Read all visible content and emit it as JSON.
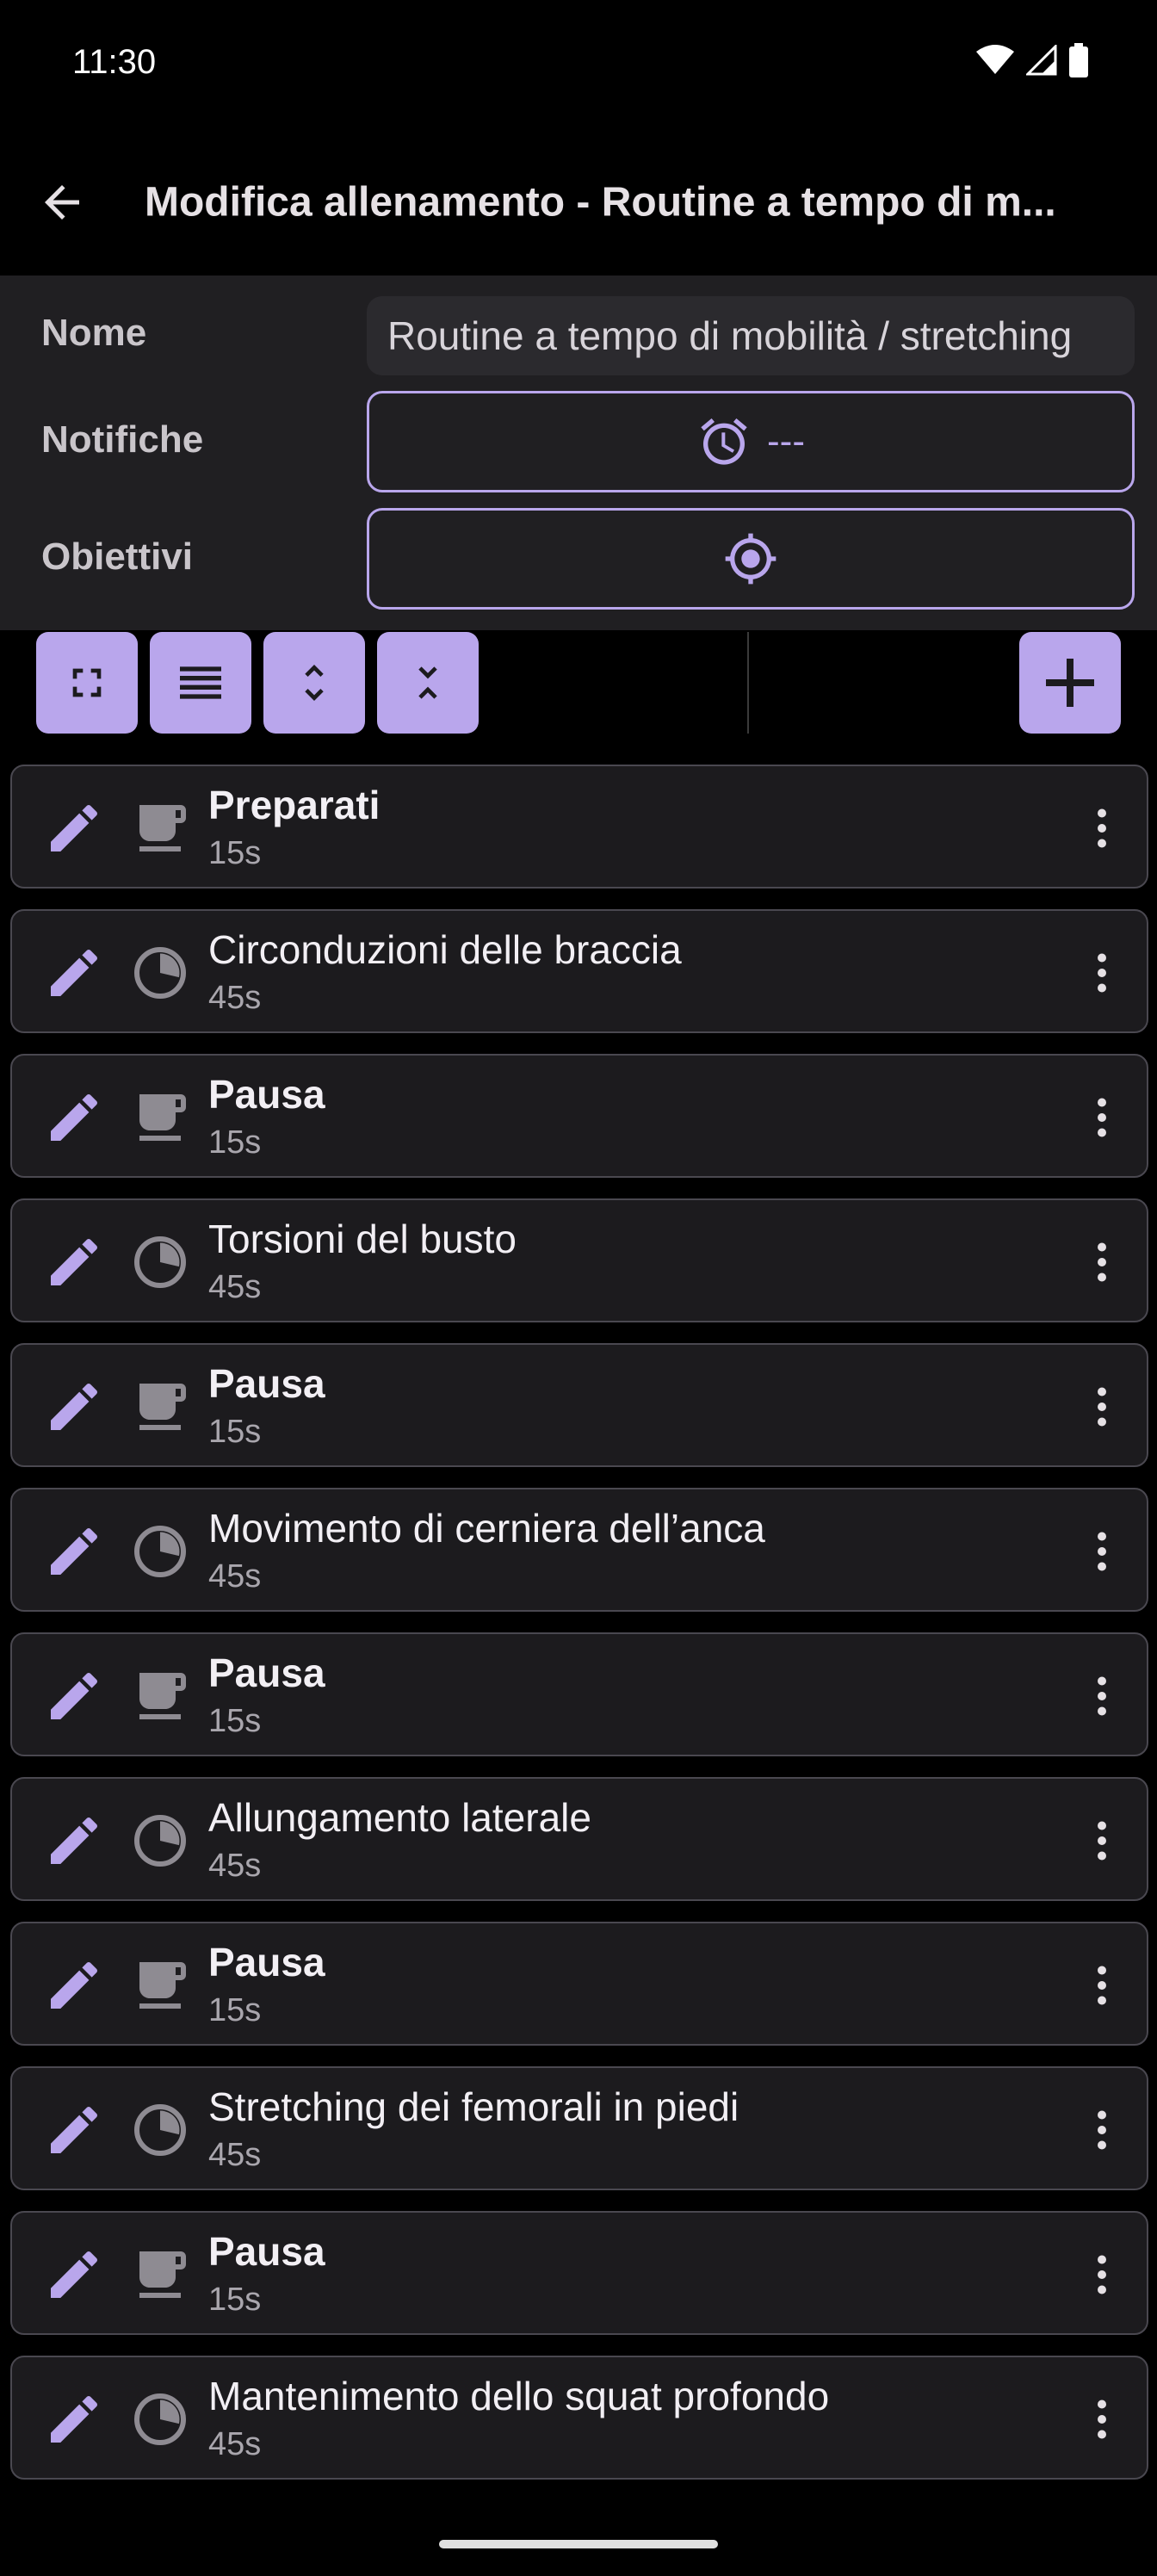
{
  "status": {
    "time": "11:30",
    "icons": [
      "wifi-icon",
      "signal-icon",
      "battery-icon"
    ]
  },
  "app_bar": {
    "title": "Modifica allenamento - Routine a tempo di m...",
    "back_icon": "arrow-back-icon"
  },
  "form": {
    "name_label": "Nome",
    "name_value": "Routine a tempo di mobilità / stretching",
    "notifications_label": "Notifiche",
    "notifications_value": "---",
    "goals_label": "Obiettivi"
  },
  "toolbar": {
    "buttons": [
      "fullscreen-icon",
      "list-icon",
      "expand-icon",
      "collapse-icon"
    ],
    "add_icon": "plus-icon"
  },
  "colors": {
    "accent": "#b9a6ec",
    "card_bg": "#1c1b1e",
    "panel_bg": "#201f22"
  },
  "items": [
    {
      "title": "Preparati",
      "duration": "15s",
      "kind": "rest"
    },
    {
      "title": "Circonduzioni delle braccia",
      "duration": "45s",
      "kind": "timer"
    },
    {
      "title": "Pausa",
      "duration": "15s",
      "kind": "rest"
    },
    {
      "title": "Torsioni del busto",
      "duration": "45s",
      "kind": "timer"
    },
    {
      "title": "Pausa",
      "duration": "15s",
      "kind": "rest"
    },
    {
      "title": "Movimento di cerniera dell’anca",
      "duration": "45s",
      "kind": "timer"
    },
    {
      "title": "Pausa",
      "duration": "15s",
      "kind": "rest"
    },
    {
      "title": "Allungamento laterale",
      "duration": "45s",
      "kind": "timer"
    },
    {
      "title": "Pausa",
      "duration": "15s",
      "kind": "rest"
    },
    {
      "title": "Stretching dei femorali in piedi",
      "duration": "45s",
      "kind": "timer"
    },
    {
      "title": "Pausa",
      "duration": "15s",
      "kind": "rest"
    },
    {
      "title": "Mantenimento dello squat profondo",
      "duration": "45s",
      "kind": "timer"
    }
  ]
}
